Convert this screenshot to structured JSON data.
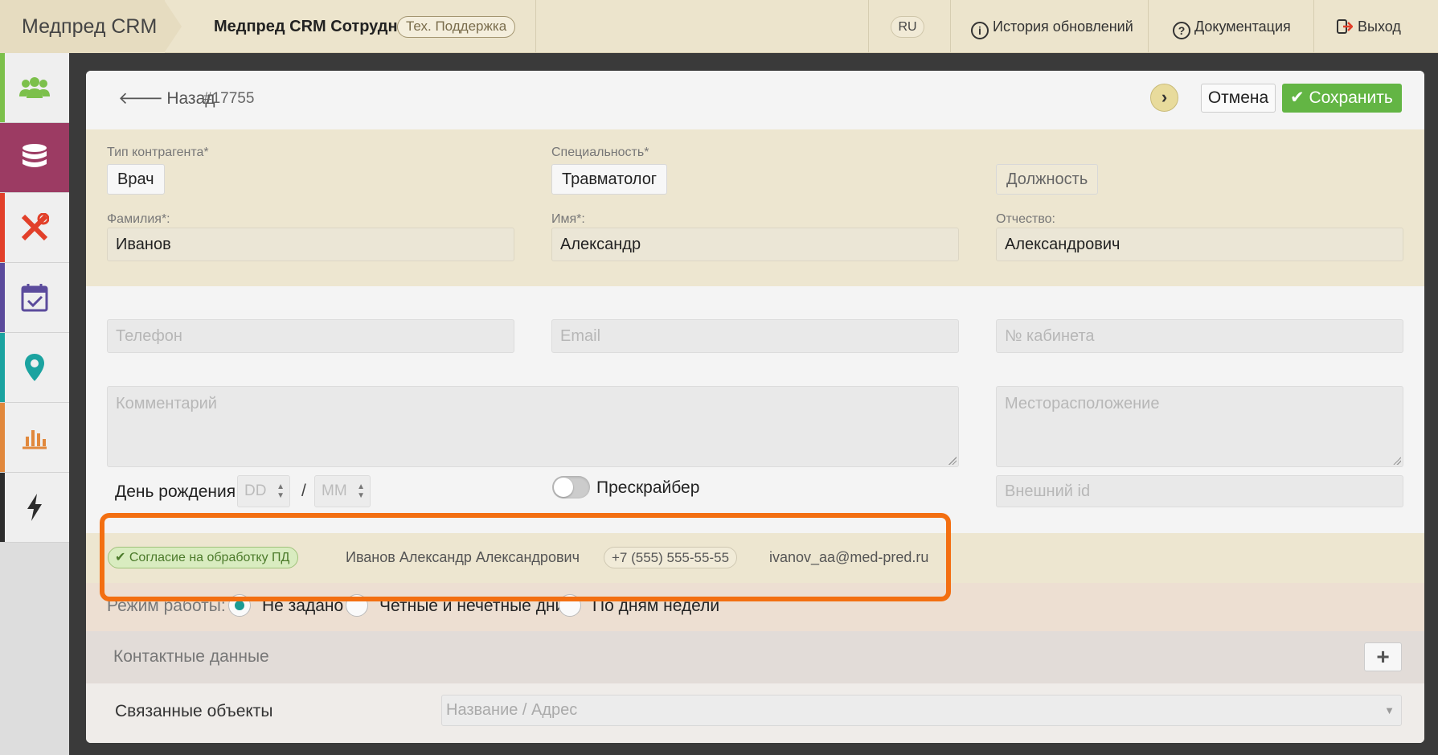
{
  "header": {
    "brand": "Медпред CRM",
    "app_title": "Медпред CRM Сотрудник",
    "support_badge": "Тех. Поддержка",
    "lang": "RU",
    "history": "История обновлений",
    "docs": "Документация",
    "logout": "Выход"
  },
  "sidebar": {
    "items": [
      {
        "icon": "users-icon",
        "color": "#7cc04b"
      },
      {
        "icon": "database-icon",
        "color": "#9c3b63"
      },
      {
        "icon": "tools-icon",
        "color": "#e2402a"
      },
      {
        "icon": "calendar-check-icon",
        "color": "#5b4b9c"
      },
      {
        "icon": "map-pin-icon",
        "color": "#1ba3a0"
      },
      {
        "icon": "bar-chart-icon",
        "color": "#e1883c"
      },
      {
        "icon": "lightning-icon",
        "color": "#2d2d2d"
      }
    ]
  },
  "toolbar": {
    "back": "Назад",
    "record_id": "#17755",
    "cancel": "Отмена",
    "save": "Сохранить"
  },
  "form": {
    "type_label": "Тип контрагента*",
    "type_value": "Врач",
    "specialty_label": "Специальность*",
    "specialty_value": "Травматолог",
    "position_button": "Должность",
    "last_name_label": "Фамилия*:",
    "last_name": "Иванов",
    "first_name_label": "Имя*:",
    "first_name": "Александр",
    "patronymic_label": "Отчество:",
    "patronymic": "Александрович",
    "phone_placeholder": "Телефон",
    "email_placeholder": "Email",
    "cabinet_placeholder": "№ кабинета",
    "comment_placeholder": "Комментарий",
    "location_placeholder": "Месторасположение",
    "birthday_label": "День рождения:",
    "day_placeholder": "DD",
    "month_placeholder": "MM",
    "birthday_separator": "/",
    "prescriber_label": "Прескрайбер",
    "external_id_placeholder": "Внешний id"
  },
  "consent": {
    "badge": "Согласие на обработку ПД",
    "name": "Иванов Александр Александрович",
    "phone": "+7 (555) 555-55-55",
    "email": "ivanov_aa@med-pred.ru"
  },
  "work_mode": {
    "label": "Режим работы:",
    "options": [
      "Не задано",
      "Четные и нечетные дни",
      "По дням недели"
    ],
    "selected": "Не задано"
  },
  "contacts": {
    "label": "Контактные данные",
    "add": "+"
  },
  "linked": {
    "label": "Связанные объекты",
    "placeholder": "Название / Адрес"
  }
}
